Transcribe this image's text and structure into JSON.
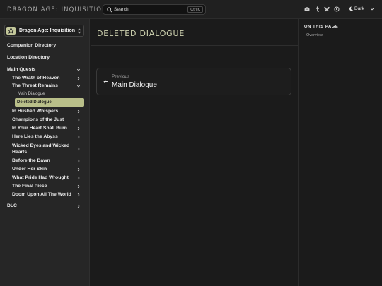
{
  "header": {
    "brand": "DRAGON AGE: INQUISITION",
    "search_placeholder": "Search",
    "search_shortcut": "Ctrl K",
    "theme_label": "Dark",
    "social_icons": [
      "discord-icon",
      "tumblr-icon",
      "bluesky-icon",
      "patreon-icon"
    ]
  },
  "sidebar": {
    "site_name": "Dragon Age: Inquisition",
    "accent": "#b9bf89",
    "items": [
      {
        "label": "Companion Directory"
      },
      {
        "label": "Location Directory"
      },
      {
        "label": "Main Quests"
      },
      {
        "label": "The Wrath of Heaven"
      },
      {
        "label": "The Threat Remains"
      },
      {
        "label": "Main Dialogue"
      },
      {
        "label": "Deleted Dialogue"
      },
      {
        "label": "In Hushed Whispers"
      },
      {
        "label": "Champions of the Just"
      },
      {
        "label": "In Your Heart Shall Burn"
      },
      {
        "label": "Here Lies the Abyss"
      },
      {
        "label": "Wicked Eyes and Wicked Hearts"
      },
      {
        "label": "Before the Dawn"
      },
      {
        "label": "Under Her Skin"
      },
      {
        "label": "What Pride Had Wrought"
      },
      {
        "label": "The Final Piece"
      },
      {
        "label": "Doom Upon All The World"
      },
      {
        "label": "DLC"
      }
    ]
  },
  "main": {
    "title": "DELETED DIALOGUE",
    "prev_label": "Previous",
    "prev_title": "Main Dialogue"
  },
  "toc": {
    "heading": "ON THIS PAGE",
    "items": [
      "Overview"
    ]
  }
}
